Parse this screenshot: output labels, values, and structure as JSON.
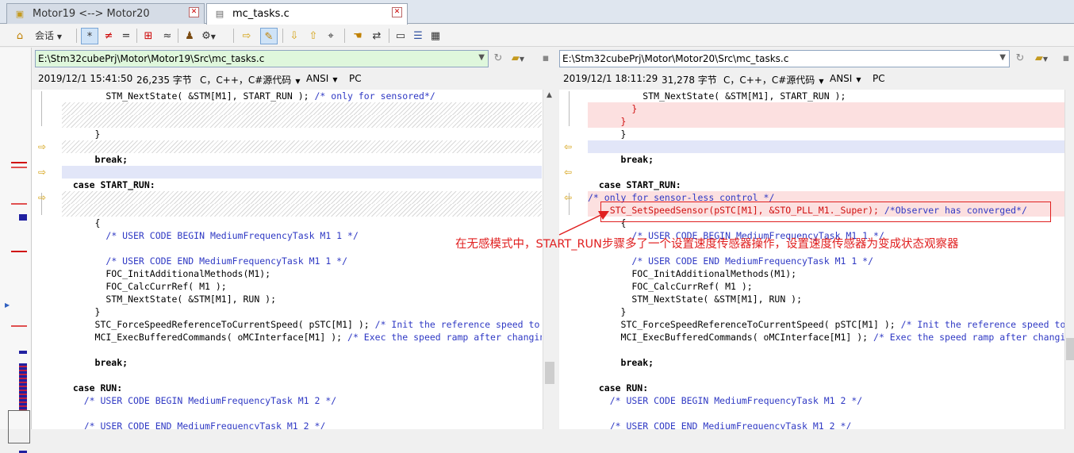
{
  "tabs": [
    {
      "label": "Motor19 <--> Motor20",
      "icon": "folder-compare-icon"
    },
    {
      "label": "mc_tasks.c",
      "icon": "file-compare-icon"
    }
  ],
  "toolbar": {
    "session_label": "会话",
    "buttons": [
      "home-icon",
      "session-menu",
      "asterisk-icon",
      "not-equal-icon",
      "equal-icon",
      "diff-icon",
      "approx-icon",
      "person-icon",
      "rules-icon",
      "right-arrow-icon",
      "edit-icon",
      "next-diff-icon",
      "prev-diff-icon",
      "binoculars-icon",
      "hand-icon",
      "swap-icon",
      "ruler-icon",
      "list-icon"
    ]
  },
  "left": {
    "path": "E:\\Stm32cubePrj\\Motor\\Motor19\\Src\\mc_tasks.c",
    "date": "2019/12/1 15:41:50",
    "size": "26,235 字节",
    "format": "C，C++，C#源代码",
    "encoding": "ANSI",
    "line_ending": "PC",
    "lines": [
      {
        "t": "        STM_NextState( &STM[M1], START_RUN ); ",
        "c": "/* only for sensored*/",
        "s": ""
      },
      {
        "t": "",
        "c": "",
        "s": "hatch"
      },
      {
        "t": "",
        "c": "",
        "s": "hatch"
      },
      {
        "t": "      }",
        "c": "",
        "s": ""
      },
      {
        "t": "",
        "c": "",
        "s": "hatch"
      },
      {
        "t": "      break;",
        "c": "",
        "s": "bold"
      },
      {
        "t": "",
        "c": "",
        "s": "blue"
      },
      {
        "t": "  case START_RUN:",
        "c": "",
        "s": "bold"
      },
      {
        "t": "",
        "c": "",
        "s": "hatch"
      },
      {
        "t": "",
        "c": "",
        "s": "hatch"
      },
      {
        "t": "      {",
        "c": "",
        "s": ""
      },
      {
        "t": "        ",
        "c": "/* USER CODE BEGIN MediumFrequencyTask M1 1 */",
        "s": ""
      },
      {
        "t": "",
        "c": "",
        "s": ""
      },
      {
        "t": "        ",
        "c": "/* USER CODE END MediumFrequencyTask M1 1 */",
        "s": ""
      },
      {
        "t": "        FOC_InitAdditionalMethods(M1);",
        "c": "",
        "s": ""
      },
      {
        "t": "        FOC_CalcCurrRef( M1 );",
        "c": "",
        "s": ""
      },
      {
        "t": "        STM_NextState( &STM[M1], RUN );",
        "c": "",
        "s": ""
      },
      {
        "t": "      }",
        "c": "",
        "s": ""
      },
      {
        "t": "      STC_ForceSpeedReferenceToCurrentSpeed( pSTC[M1] ); ",
        "c": "/* Init the reference speed to c",
        "s": ""
      },
      {
        "t": "      MCI_ExecBufferedCommands( oMCInterface[M1] ); ",
        "c": "/* Exec the speed ramp after changing",
        "s": ""
      },
      {
        "t": "",
        "c": "",
        "s": ""
      },
      {
        "t": "      break;",
        "c": "",
        "s": "bold"
      },
      {
        "t": "",
        "c": "",
        "s": ""
      },
      {
        "t": "  case RUN:",
        "c": "",
        "s": "bold"
      },
      {
        "t": "    ",
        "c": "/* USER CODE BEGIN MediumFrequencyTask M1 2 */",
        "s": ""
      },
      {
        "t": "",
        "c": "",
        "s": ""
      },
      {
        "t": "    ",
        "c": "/* USER CODE END MediumFrequencyTask M1 2 */",
        "s": ""
      }
    ]
  },
  "right": {
    "path": "E:\\Stm32cubePrj\\Motor\\Motor20\\Src\\mc_tasks.c",
    "date": "2019/12/1 18:11:29",
    "size": "31,278 字节",
    "format": "C，C++，C#源代码",
    "encoding": "ANSI",
    "line_ending": "PC",
    "lines": [
      {
        "t": "          STM_NextState( &STM[M1], START_RUN );",
        "c": "",
        "s": ""
      },
      {
        "t": "        }",
        "c": "",
        "s": "red"
      },
      {
        "t": "      }",
        "c": "",
        "s": "red"
      },
      {
        "t": "      }",
        "c": "",
        "s": ""
      },
      {
        "t": "",
        "c": "",
        "s": "blue"
      },
      {
        "t": "      break;",
        "c": "",
        "s": "bold"
      },
      {
        "t": "",
        "c": "",
        "s": ""
      },
      {
        "t": "  case START_RUN:",
        "c": "",
        "s": "bold"
      },
      {
        "t": "",
        "c": "/* only for sensor-less control */",
        "s": "red"
      },
      {
        "t": "    STC_SetSpeedSensor(pSTC[M1], &STO_PLL_M1._Super); ",
        "c": "/*Observer has converged*/",
        "s": "red"
      },
      {
        "t": "      {",
        "c": "",
        "s": ""
      },
      {
        "t": "        ",
        "c": "/* USER CODE BEGIN MediumFrequencyTask M1 1 */",
        "s": ""
      },
      {
        "t": "",
        "c": "",
        "s": ""
      },
      {
        "t": "        ",
        "c": "/* USER CODE END MediumFrequencyTask M1 1 */",
        "s": ""
      },
      {
        "t": "        FOC_InitAdditionalMethods(M1);",
        "c": "",
        "s": ""
      },
      {
        "t": "        FOC_CalcCurrRef( M1 );",
        "c": "",
        "s": ""
      },
      {
        "t": "        STM_NextState( &STM[M1], RUN );",
        "c": "",
        "s": ""
      },
      {
        "t": "      }",
        "c": "",
        "s": ""
      },
      {
        "t": "      STC_ForceSpeedReferenceToCurrentSpeed( pSTC[M1] ); ",
        "c": "/* Init the reference speed to",
        "s": ""
      },
      {
        "t": "      MCI_ExecBufferedCommands( oMCInterface[M1] ); ",
        "c": "/* Exec the speed ramp after changing",
        "s": ""
      },
      {
        "t": "",
        "c": "",
        "s": ""
      },
      {
        "t": "      break;",
        "c": "",
        "s": "bold"
      },
      {
        "t": "",
        "c": "",
        "s": ""
      },
      {
        "t": "  case RUN:",
        "c": "",
        "s": "bold"
      },
      {
        "t": "    ",
        "c": "/* USER CODE BEGIN MediumFrequencyTask M1 2 */",
        "s": ""
      },
      {
        "t": "",
        "c": "",
        "s": ""
      },
      {
        "t": "    ",
        "c": "/* USER CODE END MediumFrequencyTask M1 2 */",
        "s": ""
      }
    ]
  },
  "annotation": {
    "text": "在无感模式中，START_RUN步骤多了一个设置速度传感器操作，设置速度传感器为变成状态观察器",
    "color": "#e02020"
  },
  "colors": {
    "diff_blue": "#e2e6f8",
    "diff_red": "#fce0e0",
    "comment": "#2f39c4",
    "left_path_bg": "#dff7dc"
  }
}
